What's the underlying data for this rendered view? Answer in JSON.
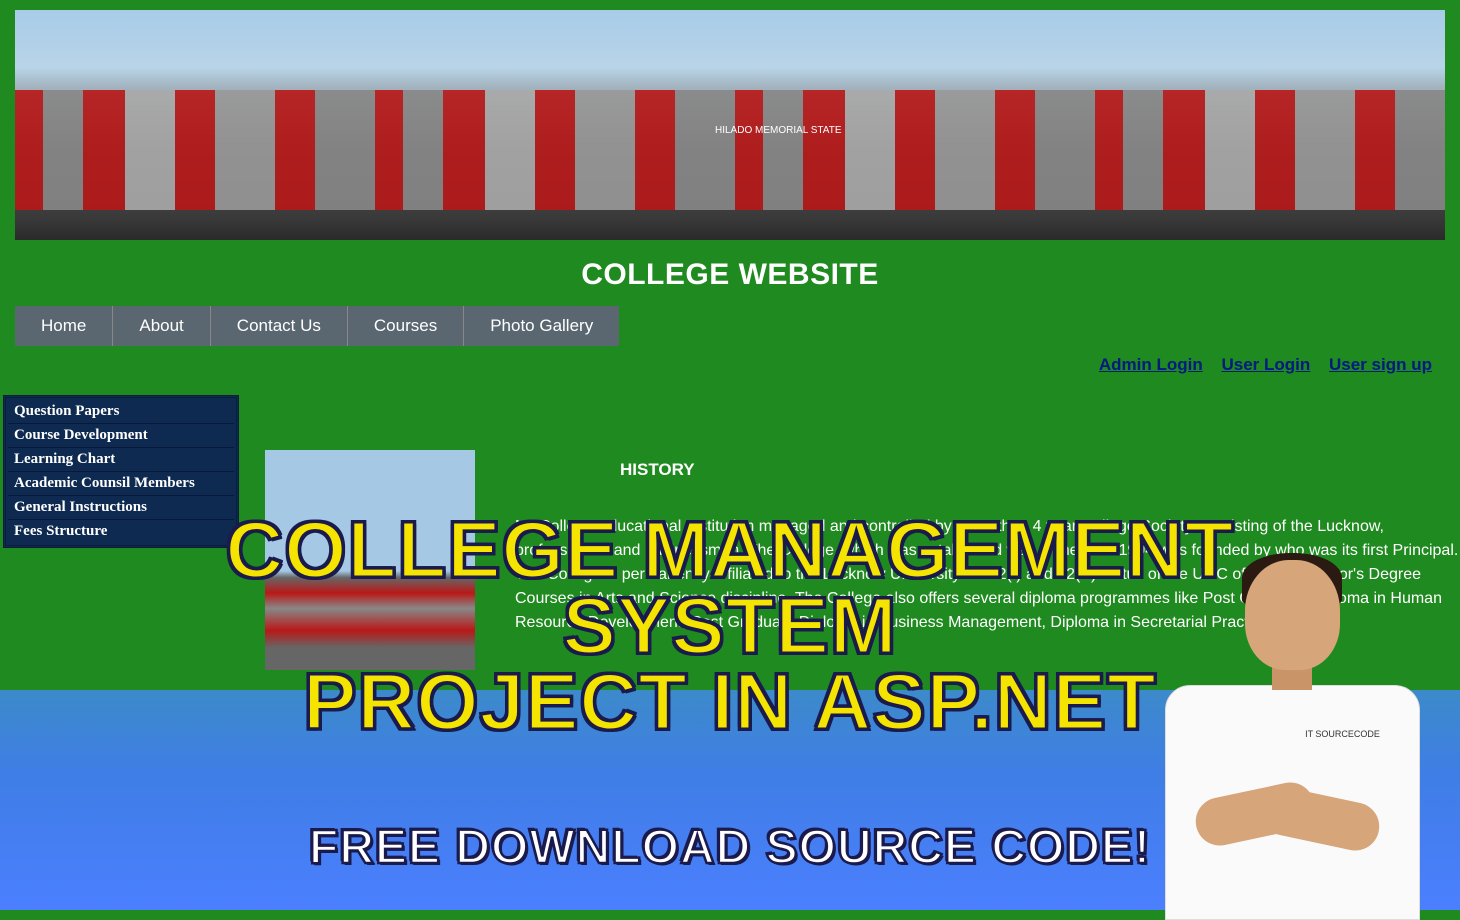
{
  "site_title": "COLLEGE WEBSITE",
  "banner": {
    "label": "HILADO MEMORIAL STATE"
  },
  "nav": {
    "items": [
      {
        "label": "Home"
      },
      {
        "label": "About"
      },
      {
        "label": "Contact Us"
      },
      {
        "label": "Courses"
      },
      {
        "label": "Photo Gallery"
      }
    ]
  },
  "auth": {
    "admin": "Admin Login",
    "user_login": "User Login",
    "user_signup": "User sign up"
  },
  "sidebar": {
    "items": [
      {
        "label": "Question Papers"
      },
      {
        "label": "Course Development"
      },
      {
        "label": "Learning Chart"
      },
      {
        "label": "Academic Counsil Members"
      },
      {
        "label": "General Instructions"
      },
      {
        "label": "Fees Structure"
      }
    ]
  },
  "content": {
    "history_heading": "HISTORY",
    "history_body": "MYCollege Educational Institution managed and controlled by more than 4 year College Society consisting of the Lucknow, professionals and businessmen. The College, which was established was in the year 1994 was founded by who was its first Principal. The College is permanently affiliated to the Lucknow University with 2(f) and 12(B) status of the UGC offering Bachelor's Degree Courses in Arts and Science discipline. The College also offers several diploma programmes like Post Graduate Diploma in Human Resource Development, Post Graduate Diploma in Business Management, Diploma in Secretarial Practices."
  },
  "overlay": {
    "title_line1": "COLLEGE MANAGEMENT",
    "title_line2": "SYSTEM",
    "title_line3": "PROJECT IN ASP.NET",
    "sub": "FREE DOWNLOAD SOURCE CODE!"
  },
  "person": {
    "shirt_logo": "IT SOURCECODE"
  }
}
